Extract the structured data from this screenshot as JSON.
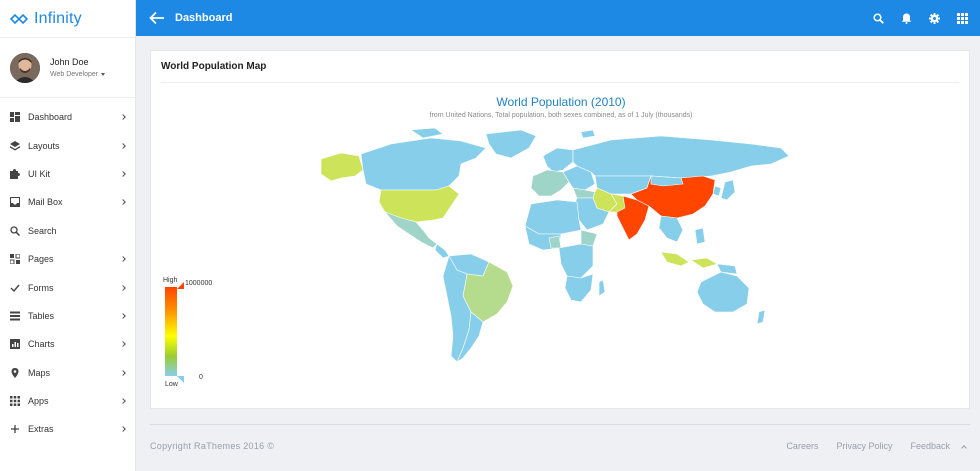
{
  "brand": {
    "name": "Infinity"
  },
  "user": {
    "name": "John Doe",
    "role": "Web Developer"
  },
  "sidebar": {
    "items": [
      {
        "label": "Dashboard",
        "icon": "dashboard-icon",
        "has_children": true
      },
      {
        "label": "Layouts",
        "icon": "layers-icon",
        "has_children": true
      },
      {
        "label": "UI Kit",
        "icon": "puzzle-icon",
        "has_children": true
      },
      {
        "label": "Mail Box",
        "icon": "inbox-icon",
        "has_children": true
      },
      {
        "label": "Search",
        "icon": "search-icon",
        "has_children": false
      },
      {
        "label": "Pages",
        "icon": "pages-icon",
        "has_children": true
      },
      {
        "label": "Forms",
        "icon": "check-icon",
        "has_children": true
      },
      {
        "label": "Tables",
        "icon": "table-icon",
        "has_children": true
      },
      {
        "label": "Charts",
        "icon": "chart-icon",
        "has_children": true
      },
      {
        "label": "Maps",
        "icon": "map-pin-icon",
        "has_children": true
      },
      {
        "label": "Apps",
        "icon": "apps-grid-icon",
        "has_children": true
      },
      {
        "label": "Extras",
        "icon": "plus-icon",
        "has_children": true
      }
    ]
  },
  "topbar": {
    "title": "Dashboard",
    "icons": [
      "search-icon",
      "bell-icon",
      "gear-icon",
      "apps-grid-icon"
    ]
  },
  "card": {
    "title": "World Population Map",
    "map_title": "World Population (2010)",
    "map_subtitle": "from United Nations, Total population, both sexes combined, as of 1 July (thousands)",
    "legend": {
      "high_label": "High",
      "low_label": "Low",
      "max_value": "1000000",
      "min_value": "0"
    }
  },
  "colors": {
    "accent": "#1e88e5",
    "scale_high": "#ff4500",
    "scale_low": "#87ceeb",
    "scale_mid_yellow": "#ffff00",
    "scale_mid_green": "#9acd32"
  },
  "footer": {
    "copyright": "Copyright RaThemes 2016 ©",
    "links": [
      "Careers",
      "Privacy Policy",
      "Feedback"
    ]
  }
}
